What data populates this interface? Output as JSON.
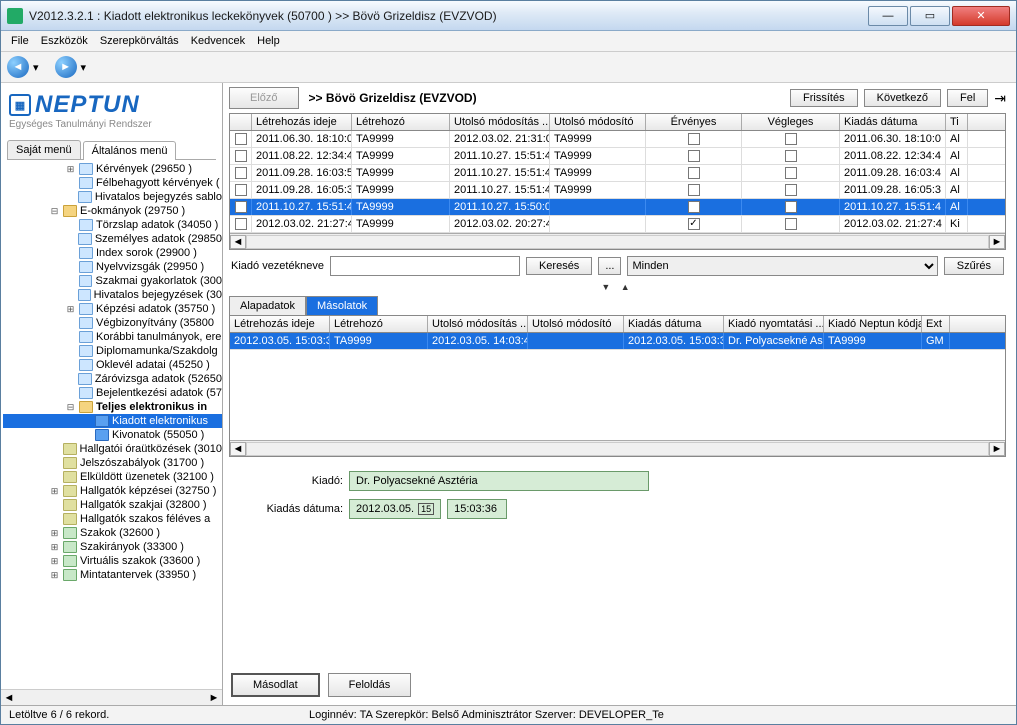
{
  "window": {
    "title": "V2012.3.2.1 : Kiadott elektronikus leckekönyvek (50700  )  >> Bövö Grizeldisz (EVZVOD)"
  },
  "menubar": [
    "File",
    "Eszközök",
    "Szerepkörváltás",
    "Kedvencek",
    "Help"
  ],
  "logo": {
    "main": "NEPTUN",
    "sub": "Egységes Tanulmányi Rendszer"
  },
  "left_tabs": {
    "a": "Saját menü",
    "b": "Általános menü"
  },
  "tree": [
    {
      "ind": 3,
      "t": "+",
      "i": "doc",
      "label": "Kérvények (29650  )"
    },
    {
      "ind": 3,
      "t": "",
      "i": "doc",
      "label": "Félbehagyott kérvények ("
    },
    {
      "ind": 3,
      "t": "",
      "i": "doc",
      "label": "Hivatalos bejegyzés sablo"
    },
    {
      "ind": 2,
      "t": "-",
      "i": "fold",
      "label": "E-okmányok (29750  )"
    },
    {
      "ind": 3,
      "t": "",
      "i": "doc",
      "label": "Törzslap adatok (34050  )"
    },
    {
      "ind": 3,
      "t": "",
      "i": "doc",
      "label": "Személyes adatok (29850"
    },
    {
      "ind": 3,
      "t": "",
      "i": "doc",
      "label": "Index sorok (29900  )"
    },
    {
      "ind": 3,
      "t": "",
      "i": "doc",
      "label": "Nyelvvizsgák (29950  )"
    },
    {
      "ind": 3,
      "t": "",
      "i": "doc",
      "label": "Szakmai gyakorlatok (300"
    },
    {
      "ind": 3,
      "t": "",
      "i": "doc",
      "label": "Hivatalos bejegyzések (30"
    },
    {
      "ind": 3,
      "t": "+",
      "i": "doc",
      "label": "Képzési adatok (35750  )"
    },
    {
      "ind": 3,
      "t": "",
      "i": "doc",
      "label": "Végbizonyítvány (35800"
    },
    {
      "ind": 3,
      "t": "",
      "i": "doc",
      "label": "Korábbi tanulmányok, ere"
    },
    {
      "ind": 3,
      "t": "",
      "i": "doc",
      "label": "Diplomamunka/Szakdolg"
    },
    {
      "ind": 3,
      "t": "",
      "i": "doc",
      "label": "Oklevél adatai (45250  )"
    },
    {
      "ind": 3,
      "t": "",
      "i": "doc",
      "label": "Záróvizsga adatok (52650"
    },
    {
      "ind": 3,
      "t": "",
      "i": "doc",
      "label": "Bejelentkezési adatok (57"
    },
    {
      "ind": 3,
      "t": "-",
      "i": "fold",
      "label": "Teljes elektronikus in",
      "bold": true
    },
    {
      "ind": 4,
      "t": "",
      "i": "blue",
      "label": "Kiadott elektronikus",
      "sel": true
    },
    {
      "ind": 4,
      "t": "",
      "i": "blue",
      "label": "Kivonatok (55050  )"
    },
    {
      "ind": 2,
      "t": "",
      "i": "gear",
      "label": "Hallgatói óraütközések (3010"
    },
    {
      "ind": 2,
      "t": "",
      "i": "gear",
      "label": "Jelszószabályok (31700  )"
    },
    {
      "ind": 2,
      "t": "",
      "i": "gear",
      "label": "Elküldött üzenetek (32100  )"
    },
    {
      "ind": 2,
      "t": "+",
      "i": "gear",
      "label": "Hallgatók képzései (32750  )"
    },
    {
      "ind": 2,
      "t": "",
      "i": "gear",
      "label": "Hallgatók szakjai (32800  )"
    },
    {
      "ind": 2,
      "t": "",
      "i": "gear",
      "label": "Hallgatók szakos féléves a"
    },
    {
      "ind": 2,
      "t": "+",
      "i": "cube",
      "label": "Szakok (32600  )"
    },
    {
      "ind": 2,
      "t": "+",
      "i": "cube",
      "label": "Szakirányok (33300  )"
    },
    {
      "ind": 2,
      "t": "+",
      "i": "cube",
      "label": "Virtuális szakok (33600  )"
    },
    {
      "ind": 2,
      "t": "+",
      "i": "cube",
      "label": "Mintatantervek (33950  )"
    }
  ],
  "toolbar": {
    "prev": "Előző",
    "crumb": ">> Bövö Grizeldisz (EVZVOD)",
    "refresh": "Frissítés",
    "next": "Következő",
    "up": "Fel"
  },
  "grid1": {
    "headers": [
      "",
      "Létrehozás ideje",
      "Létrehozó",
      "Utolsó módosítás ...",
      "Utolsó módosító",
      "Érvényes",
      "Végleges",
      "Kiadás dátuma",
      "Ti"
    ],
    "rows": [
      {
        "cells": [
          "",
          "2011.06.30. 18:10:0",
          "TA9999",
          "2012.03.02. 21:31:0",
          "TA9999",
          "",
          "",
          "2011.06.30. 18:10:0",
          "Al"
        ]
      },
      {
        "cells": [
          "",
          "2011.08.22. 12:34:4",
          "TA9999",
          "2011.10.27. 15:51:4",
          "TA9999",
          "",
          "",
          "2011.08.22. 12:34:4",
          "Al"
        ]
      },
      {
        "cells": [
          "",
          "2011.09.28. 16:03:5",
          "TA9999",
          "2011.10.27. 15:51:4",
          "TA9999",
          "",
          "",
          "2011.09.28. 16:03:4",
          "Al"
        ]
      },
      {
        "cells": [
          "",
          "2011.09.28. 16:05:3",
          "TA9999",
          "2011.10.27. 15:51:4",
          "TA9999",
          "",
          "",
          "2011.09.28. 16:05:3",
          "Al"
        ]
      },
      {
        "cells": [
          "",
          "2011.10.27. 15:51:4",
          "TA9999",
          "2011.10.27. 15:50:0",
          "",
          "on",
          "on",
          "2011.10.27. 15:51:4",
          "Al"
        ],
        "sel": true
      },
      {
        "cells": [
          "",
          "2012.03.02. 21:27:4",
          "TA9999",
          "2012.03.02. 20:27:4",
          "",
          "on",
          "",
          "2012.03.02. 21:27:4",
          "Ki"
        ]
      }
    ]
  },
  "search": {
    "label": "Kiadó vezetékneve",
    "btn": "Keresés",
    "dots": "...",
    "select": "Minden",
    "filter": "Szűrés"
  },
  "subtabs": {
    "a": "Alapadatok",
    "b": "Másolatok"
  },
  "grid2": {
    "headers": [
      "Létrehozás ideje",
      "Létrehozó",
      "Utolsó módosítás ...",
      "Utolsó módosító",
      "Kiadás dátuma",
      "Kiadó nyomtatási ...",
      "Kiadó Neptun kódja",
      "Ext"
    ],
    "rows": [
      {
        "cells": [
          "2012.03.05. 15:03:3",
          "TA9999",
          "2012.03.05. 14:03:4",
          "",
          "2012.03.05. 15:03:3",
          "Dr. Polyacsekné As",
          "TA9999",
          "GM"
        ],
        "sel": true
      }
    ]
  },
  "form": {
    "kiado_lbl": "Kiadó:",
    "kiado_val": "Dr. Polyacsekné Asztéria",
    "date_lbl": "Kiadás dátuma:",
    "date_val": "2012.03.05.",
    "time_val": "15:03:36"
  },
  "bottom_btns": {
    "a": "Másodlat",
    "b": "Feloldás"
  },
  "status": {
    "left": "Letöltve 6 / 6 rekord.",
    "mid": "Loginnév: TA    Szerepkör: Belső Adminisztrátor    Szerver: DEVELOPER_Te"
  }
}
